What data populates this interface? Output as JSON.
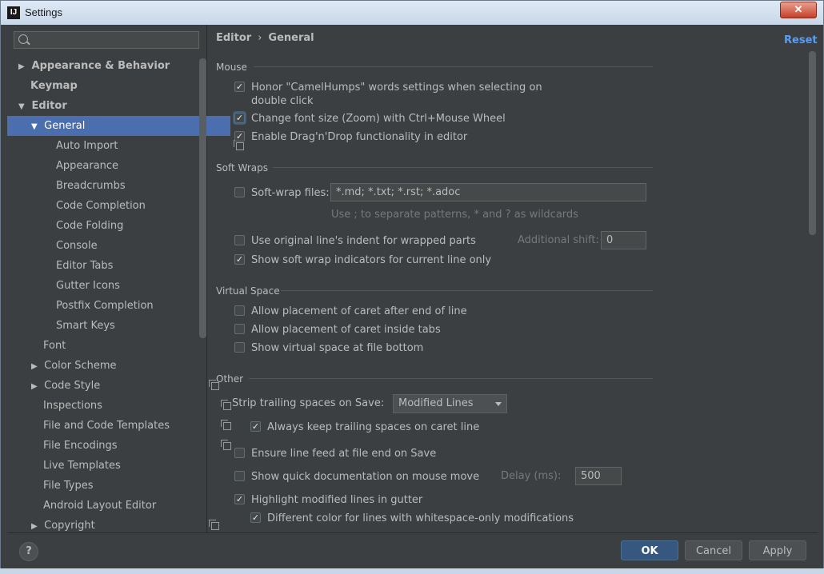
{
  "window": {
    "title": "Settings",
    "app_icon": "IJ",
    "close_label": "✕"
  },
  "search": {
    "placeholder": ""
  },
  "sidebar": {
    "items": [
      {
        "label": "Appearance & Behavior"
      },
      {
        "label": "Keymap"
      },
      {
        "label": "Editor"
      },
      {
        "label": "General"
      },
      {
        "label": "Auto Import"
      },
      {
        "label": "Appearance"
      },
      {
        "label": "Breadcrumbs"
      },
      {
        "label": "Code Completion"
      },
      {
        "label": "Code Folding"
      },
      {
        "label": "Console"
      },
      {
        "label": "Editor Tabs"
      },
      {
        "label": "Gutter Icons"
      },
      {
        "label": "Postfix Completion"
      },
      {
        "label": "Smart Keys"
      },
      {
        "label": "Font"
      },
      {
        "label": "Color Scheme"
      },
      {
        "label": "Code Style"
      },
      {
        "label": "Inspections"
      },
      {
        "label": "File and Code Templates"
      },
      {
        "label": "File Encodings"
      },
      {
        "label": "Live Templates"
      },
      {
        "label": "File Types"
      },
      {
        "label": "Android Layout Editor"
      },
      {
        "label": "Copyright"
      }
    ]
  },
  "breadcrumb": {
    "parent": "Editor",
    "separator": "›",
    "current": "General"
  },
  "reset_label": "Reset",
  "sections": {
    "mouse": {
      "title": "Mouse",
      "camelhumps_line1": "Honor \"CamelHumps\" words settings when selecting on",
      "camelhumps_line2": "double click",
      "zoom": "Change font size (Zoom) with Ctrl+Mouse Wheel",
      "dragdrop": "Enable Drag'n'Drop functionality in editor"
    },
    "soft_wraps": {
      "title": "Soft Wraps",
      "softwrap_files": "Soft-wrap files:",
      "softwrap_value": "*.md; *.txt; *.rst; *.adoc",
      "hint": "Use ; to separate patterns, * and ? as wildcards",
      "original_indent": "Use original line's indent for wrapped parts",
      "additional_shift_label": "Additional shift:",
      "additional_shift_value": "0",
      "show_indicators": "Show soft wrap indicators for current line only"
    },
    "virtual_space": {
      "title": "Virtual Space",
      "caret_after_end": "Allow placement of caret after end of line",
      "caret_inside_tabs": "Allow placement of caret inside tabs",
      "virtual_space_bottom": "Show virtual space at file bottom"
    },
    "other": {
      "title": "Other",
      "strip_label": "Strip trailing spaces on Save:",
      "strip_value": "Modified Lines",
      "keep_trailing": "Always keep trailing spaces on caret line",
      "line_feed": "Ensure line feed at file end on Save",
      "quick_doc": "Show quick documentation on mouse move",
      "delay_label": "Delay (ms):",
      "delay_value": "500",
      "highlight_modified": "Highlight modified lines in gutter",
      "whitespace_color": "Different color for lines with whitespace-only modifications"
    }
  },
  "footer": {
    "help": "?",
    "ok": "OK",
    "cancel": "Cancel",
    "apply": "Apply"
  },
  "colors": {
    "accent": "#4b6eaf",
    "link": "#589df6",
    "background": "#3c3f41",
    "primary_button": "#365880"
  }
}
